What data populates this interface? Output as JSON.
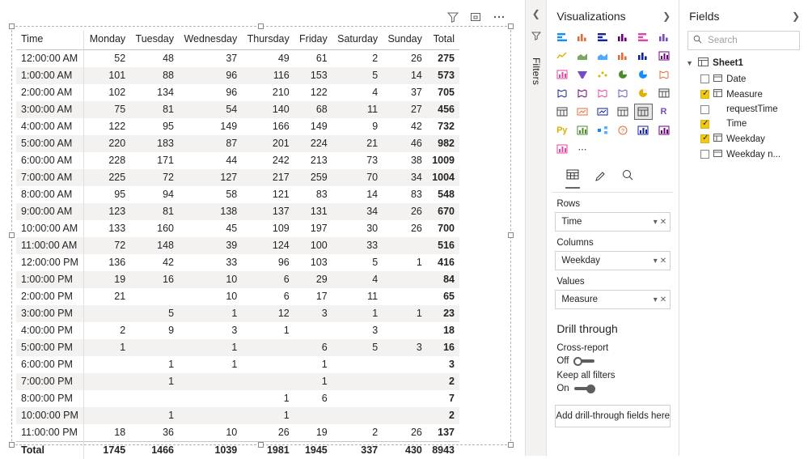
{
  "visual_toolbar": {
    "filter_icon": "filter-icon",
    "focus_icon": "focus-mode-icon",
    "more_icon": "more-options-icon"
  },
  "matrix": {
    "columns": [
      "Time",
      "Monday",
      "Tuesday",
      "Wednesday",
      "Thursday",
      "Friday",
      "Saturday",
      "Sunday",
      "Total"
    ],
    "rows": [
      {
        "label": "12:00:00 AM",
        "values": [
          "52",
          "48",
          "37",
          "49",
          "61",
          "2",
          "26",
          "275"
        ]
      },
      {
        "label": "1:00:00 AM",
        "values": [
          "101",
          "88",
          "96",
          "116",
          "153",
          "5",
          "14",
          "573"
        ]
      },
      {
        "label": "2:00:00 AM",
        "values": [
          "102",
          "134",
          "96",
          "210",
          "122",
          "4",
          "37",
          "705"
        ]
      },
      {
        "label": "3:00:00 AM",
        "values": [
          "75",
          "81",
          "54",
          "140",
          "68",
          "11",
          "27",
          "456"
        ]
      },
      {
        "label": "4:00:00 AM",
        "values": [
          "122",
          "95",
          "149",
          "166",
          "149",
          "9",
          "42",
          "732"
        ]
      },
      {
        "label": "5:00:00 AM",
        "values": [
          "220",
          "183",
          "87",
          "201",
          "224",
          "21",
          "46",
          "982"
        ]
      },
      {
        "label": "6:00:00 AM",
        "values": [
          "228",
          "171",
          "44",
          "242",
          "213",
          "73",
          "38",
          "1009"
        ]
      },
      {
        "label": "7:00:00 AM",
        "values": [
          "225",
          "72",
          "127",
          "217",
          "259",
          "70",
          "34",
          "1004"
        ]
      },
      {
        "label": "8:00:00 AM",
        "values": [
          "95",
          "94",
          "58",
          "121",
          "83",
          "14",
          "83",
          "548"
        ]
      },
      {
        "label": "9:00:00 AM",
        "values": [
          "123",
          "81",
          "138",
          "137",
          "131",
          "34",
          "26",
          "670"
        ]
      },
      {
        "label": "10:00:00 AM",
        "values": [
          "133",
          "160",
          "45",
          "109",
          "197",
          "30",
          "26",
          "700"
        ]
      },
      {
        "label": "11:00:00 AM",
        "values": [
          "72",
          "148",
          "39",
          "124",
          "100",
          "33",
          "",
          "516"
        ]
      },
      {
        "label": "12:00:00 PM",
        "values": [
          "136",
          "42",
          "33",
          "96",
          "103",
          "5",
          "1",
          "416"
        ]
      },
      {
        "label": "1:00:00 PM",
        "values": [
          "19",
          "16",
          "10",
          "6",
          "29",
          "4",
          "",
          "84"
        ]
      },
      {
        "label": "2:00:00 PM",
        "values": [
          "21",
          "",
          "10",
          "6",
          "17",
          "11",
          "",
          "65"
        ]
      },
      {
        "label": "3:00:00 PM",
        "values": [
          "",
          "5",
          "1",
          "12",
          "3",
          "1",
          "1",
          "23"
        ]
      },
      {
        "label": "4:00:00 PM",
        "values": [
          "2",
          "9",
          "3",
          "1",
          "",
          "3",
          "",
          "18"
        ]
      },
      {
        "label": "5:00:00 PM",
        "values": [
          "1",
          "",
          "1",
          "",
          "6",
          "5",
          "3",
          "16"
        ]
      },
      {
        "label": "6:00:00 PM",
        "values": [
          "",
          "1",
          "1",
          "",
          "1",
          "",
          "",
          "3"
        ]
      },
      {
        "label": "7:00:00 PM",
        "values": [
          "",
          "1",
          "",
          "",
          "1",
          "",
          "",
          "2"
        ]
      },
      {
        "label": "8:00:00 PM",
        "values": [
          "",
          "",
          "",
          "1",
          "6",
          "",
          "",
          "7"
        ]
      },
      {
        "label": "10:00:00 PM",
        "values": [
          "",
          "1",
          "",
          "1",
          "",
          "",
          "",
          "2"
        ]
      },
      {
        "label": "11:00:00 PM",
        "values": [
          "18",
          "36",
          "10",
          "26",
          "19",
          "2",
          "26",
          "137"
        ]
      }
    ],
    "total_row": {
      "label": "Total",
      "values": [
        "1745",
        "1466",
        "1039",
        "1981",
        "1945",
        "337",
        "430",
        "8943"
      ]
    }
  },
  "rail": {
    "collapse_icon": "chevron-left-icon",
    "filter_glyph": "filter-icon",
    "filters_label": "Filters"
  },
  "visualizations": {
    "title": "Visualizations",
    "expand_icon": "chevron-right-icon",
    "icons": [
      "stacked-bar-chart-icon",
      "stacked-column-chart-icon",
      "clustered-bar-chart-icon",
      "clustered-column-chart-icon",
      "100-stacked-bar-chart-icon",
      "100-stacked-column-chart-icon",
      "line-chart-icon",
      "area-chart-icon",
      "stacked-area-chart-icon",
      "line-stacked-column-icon",
      "line-clustered-column-icon",
      "ribbon-chart-icon",
      "waterfall-chart-icon",
      "funnel-chart-icon",
      "scatter-chart-icon",
      "pie-chart-icon",
      "donut-chart-icon",
      "treemap-icon",
      "map-icon",
      "filled-map-icon",
      "shape-map-icon",
      "arcgis-map-icon",
      "gauge-icon",
      "card-icon",
      "multi-row-card-icon",
      "kpi-icon",
      "slicer-icon",
      "table-icon",
      "matrix-icon",
      "r-script-visual-icon",
      "python-visual-icon",
      "key-influencers-icon",
      "decomposition-tree-icon",
      "qna-icon",
      "smart-narrative-icon",
      "paginated-report-icon",
      "power-apps-icon",
      "get-more-visuals-icon"
    ],
    "selected_icon": "matrix-icon",
    "tabs": [
      "fields-tab",
      "format-tab",
      "analytics-tab"
    ],
    "active_tab": "fields-tab",
    "wells": [
      {
        "label": "Rows",
        "field": "Time"
      },
      {
        "label": "Columns",
        "field": "Weekday"
      },
      {
        "label": "Values",
        "field": "Measure"
      }
    ],
    "drill_through": {
      "title": "Drill through",
      "cross_report_label": "Cross-report",
      "cross_report_state": "Off",
      "keep_filters_label": "Keep all filters",
      "keep_filters_state": "On",
      "drop_zone": "Add drill-through fields here"
    }
  },
  "fields": {
    "title": "Fields",
    "expand_icon": "chevron-right-icon",
    "search_placeholder": "Search",
    "search_value": "",
    "table": {
      "name": "Sheet1",
      "expanded": true
    },
    "items": [
      {
        "label": "Date",
        "checked": false,
        "icon": "date-field-icon"
      },
      {
        "label": "Measure",
        "checked": true,
        "icon": "measure-field-icon"
      },
      {
        "label": "requestTime",
        "checked": false,
        "icon": "field-icon"
      },
      {
        "label": "Time",
        "checked": true,
        "icon": "field-icon"
      },
      {
        "label": "Weekday",
        "checked": true,
        "icon": "calendar-field-icon"
      },
      {
        "label": "Weekday n...",
        "checked": false,
        "icon": "date-field-icon"
      }
    ]
  }
}
